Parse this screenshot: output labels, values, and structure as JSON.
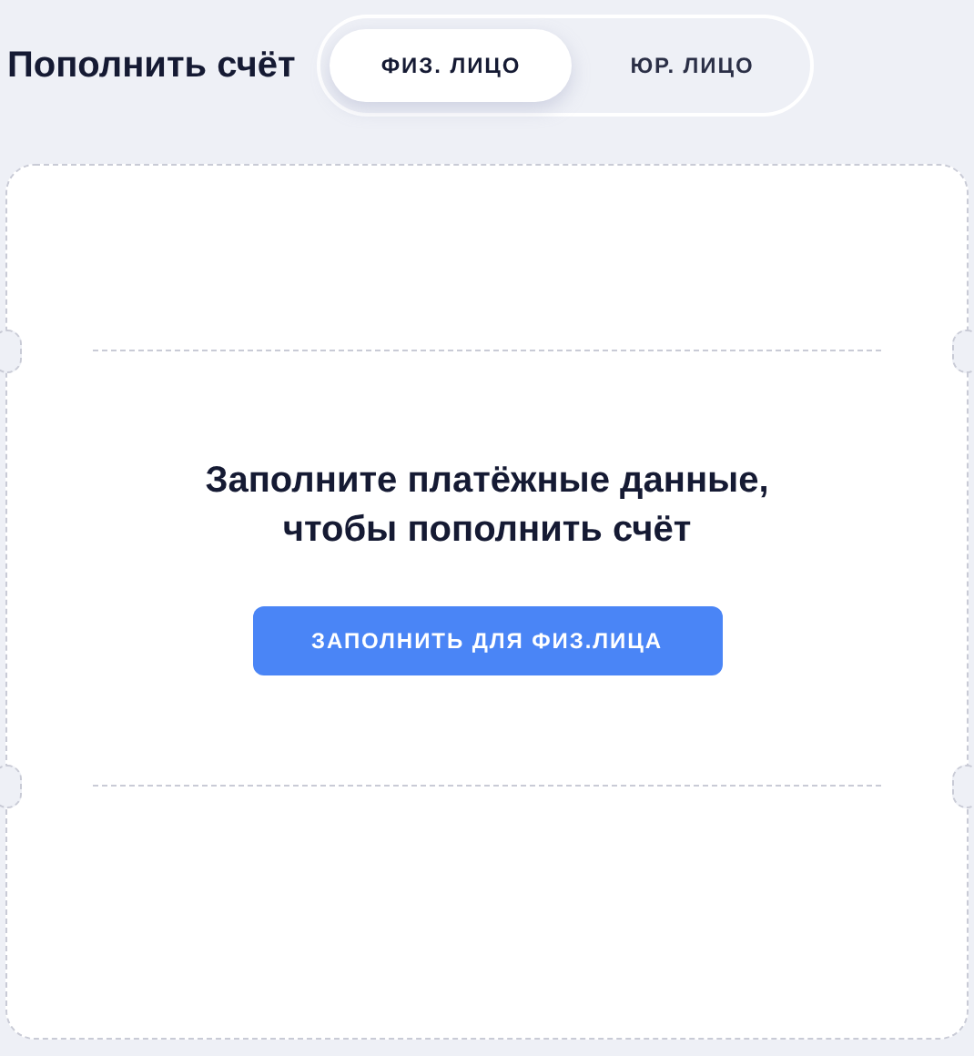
{
  "title": "Пополнить счёт",
  "tabs": [
    {
      "label": "ФИЗ. ЛИЦО",
      "selected": true
    },
    {
      "label": "ЮР. ЛИЦО",
      "selected": false
    }
  ],
  "card": {
    "message": "Заполните платёжные данные, чтобы пополнить счёт",
    "button": "ЗАПОЛНИТЬ ДЛЯ ФИЗ.ЛИЦА"
  }
}
